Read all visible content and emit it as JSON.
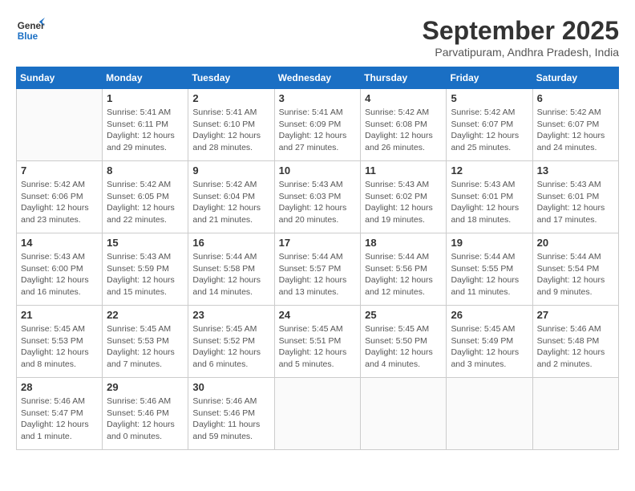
{
  "header": {
    "logo_line1": "General",
    "logo_line2": "Blue",
    "month": "September 2025",
    "location": "Parvatipuram, Andhra Pradesh, India"
  },
  "days_of_week": [
    "Sunday",
    "Monday",
    "Tuesday",
    "Wednesday",
    "Thursday",
    "Friday",
    "Saturday"
  ],
  "weeks": [
    [
      {
        "day": "",
        "info": ""
      },
      {
        "day": "1",
        "info": "Sunrise: 5:41 AM\nSunset: 6:11 PM\nDaylight: 12 hours\nand 29 minutes."
      },
      {
        "day": "2",
        "info": "Sunrise: 5:41 AM\nSunset: 6:10 PM\nDaylight: 12 hours\nand 28 minutes."
      },
      {
        "day": "3",
        "info": "Sunrise: 5:41 AM\nSunset: 6:09 PM\nDaylight: 12 hours\nand 27 minutes."
      },
      {
        "day": "4",
        "info": "Sunrise: 5:42 AM\nSunset: 6:08 PM\nDaylight: 12 hours\nand 26 minutes."
      },
      {
        "day": "5",
        "info": "Sunrise: 5:42 AM\nSunset: 6:07 PM\nDaylight: 12 hours\nand 25 minutes."
      },
      {
        "day": "6",
        "info": "Sunrise: 5:42 AM\nSunset: 6:07 PM\nDaylight: 12 hours\nand 24 minutes."
      }
    ],
    [
      {
        "day": "7",
        "info": "Sunrise: 5:42 AM\nSunset: 6:06 PM\nDaylight: 12 hours\nand 23 minutes."
      },
      {
        "day": "8",
        "info": "Sunrise: 5:42 AM\nSunset: 6:05 PM\nDaylight: 12 hours\nand 22 minutes."
      },
      {
        "day": "9",
        "info": "Sunrise: 5:42 AM\nSunset: 6:04 PM\nDaylight: 12 hours\nand 21 minutes."
      },
      {
        "day": "10",
        "info": "Sunrise: 5:43 AM\nSunset: 6:03 PM\nDaylight: 12 hours\nand 20 minutes."
      },
      {
        "day": "11",
        "info": "Sunrise: 5:43 AM\nSunset: 6:02 PM\nDaylight: 12 hours\nand 19 minutes."
      },
      {
        "day": "12",
        "info": "Sunrise: 5:43 AM\nSunset: 6:01 PM\nDaylight: 12 hours\nand 18 minutes."
      },
      {
        "day": "13",
        "info": "Sunrise: 5:43 AM\nSunset: 6:01 PM\nDaylight: 12 hours\nand 17 minutes."
      }
    ],
    [
      {
        "day": "14",
        "info": "Sunrise: 5:43 AM\nSunset: 6:00 PM\nDaylight: 12 hours\nand 16 minutes."
      },
      {
        "day": "15",
        "info": "Sunrise: 5:43 AM\nSunset: 5:59 PM\nDaylight: 12 hours\nand 15 minutes."
      },
      {
        "day": "16",
        "info": "Sunrise: 5:44 AM\nSunset: 5:58 PM\nDaylight: 12 hours\nand 14 minutes."
      },
      {
        "day": "17",
        "info": "Sunrise: 5:44 AM\nSunset: 5:57 PM\nDaylight: 12 hours\nand 13 minutes."
      },
      {
        "day": "18",
        "info": "Sunrise: 5:44 AM\nSunset: 5:56 PM\nDaylight: 12 hours\nand 12 minutes."
      },
      {
        "day": "19",
        "info": "Sunrise: 5:44 AM\nSunset: 5:55 PM\nDaylight: 12 hours\nand 11 minutes."
      },
      {
        "day": "20",
        "info": "Sunrise: 5:44 AM\nSunset: 5:54 PM\nDaylight: 12 hours\nand 9 minutes."
      }
    ],
    [
      {
        "day": "21",
        "info": "Sunrise: 5:45 AM\nSunset: 5:53 PM\nDaylight: 12 hours\nand 8 minutes."
      },
      {
        "day": "22",
        "info": "Sunrise: 5:45 AM\nSunset: 5:53 PM\nDaylight: 12 hours\nand 7 minutes."
      },
      {
        "day": "23",
        "info": "Sunrise: 5:45 AM\nSunset: 5:52 PM\nDaylight: 12 hours\nand 6 minutes."
      },
      {
        "day": "24",
        "info": "Sunrise: 5:45 AM\nSunset: 5:51 PM\nDaylight: 12 hours\nand 5 minutes."
      },
      {
        "day": "25",
        "info": "Sunrise: 5:45 AM\nSunset: 5:50 PM\nDaylight: 12 hours\nand 4 minutes."
      },
      {
        "day": "26",
        "info": "Sunrise: 5:45 AM\nSunset: 5:49 PM\nDaylight: 12 hours\nand 3 minutes."
      },
      {
        "day": "27",
        "info": "Sunrise: 5:46 AM\nSunset: 5:48 PM\nDaylight: 12 hours\nand 2 minutes."
      }
    ],
    [
      {
        "day": "28",
        "info": "Sunrise: 5:46 AM\nSunset: 5:47 PM\nDaylight: 12 hours\nand 1 minute."
      },
      {
        "day": "29",
        "info": "Sunrise: 5:46 AM\nSunset: 5:46 PM\nDaylight: 12 hours\nand 0 minutes."
      },
      {
        "day": "30",
        "info": "Sunrise: 5:46 AM\nSunset: 5:46 PM\nDaylight: 11 hours\nand 59 minutes."
      },
      {
        "day": "",
        "info": ""
      },
      {
        "day": "",
        "info": ""
      },
      {
        "day": "",
        "info": ""
      },
      {
        "day": "",
        "info": ""
      }
    ]
  ]
}
